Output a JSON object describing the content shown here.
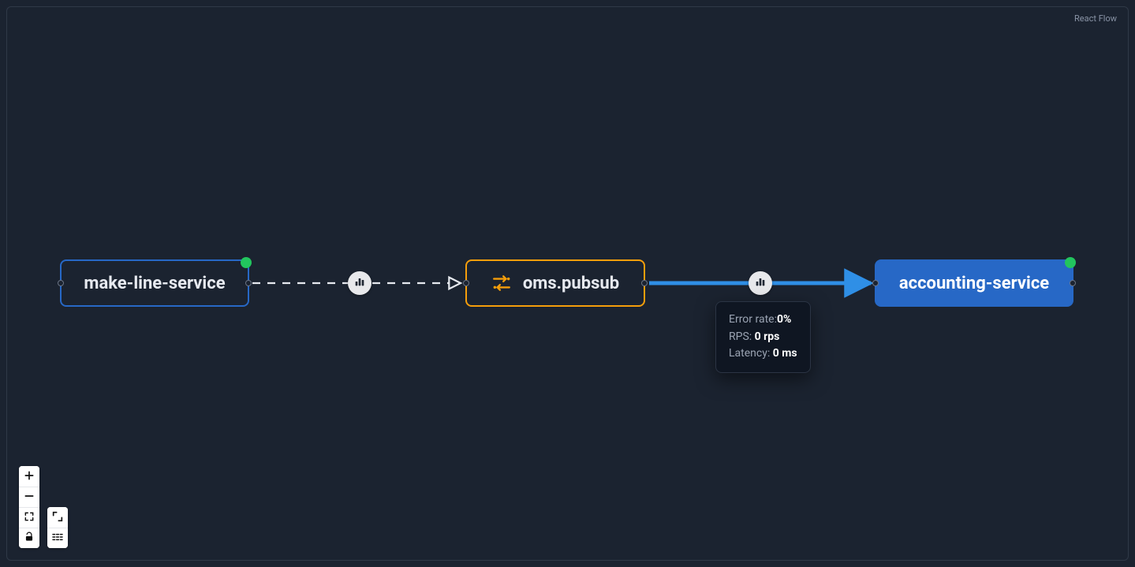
{
  "attribution": "React Flow",
  "nodes": {
    "makeLine": {
      "label": "make-line-service",
      "status": "healthy"
    },
    "pubsub": {
      "label": "oms.pubsub"
    },
    "accounting": {
      "label": "accounting-service",
      "status": "healthy"
    }
  },
  "edges": {
    "dashed": {
      "from": "makeLine",
      "to": "pubsub",
      "style": "dashed"
    },
    "solid": {
      "from": "pubsub",
      "to": "accounting",
      "style": "solid",
      "color": "#2f8fe6"
    }
  },
  "tooltip": {
    "error_rate_label": "Error rate:",
    "error_rate_value": "0%",
    "rps_label": "RPS: ",
    "rps_value": "0 rps",
    "latency_label": "Latency: ",
    "latency_value": "0 ms"
  },
  "colors": {
    "bg": "#1b2330",
    "serviceBorder": "#2768c6",
    "serviceFill": "#2768c6",
    "topicBorder": "#f59e0b",
    "statusGreen": "#22c55e",
    "edgeBlue": "#2f8fe6",
    "dashed": "#e6e9ef"
  }
}
